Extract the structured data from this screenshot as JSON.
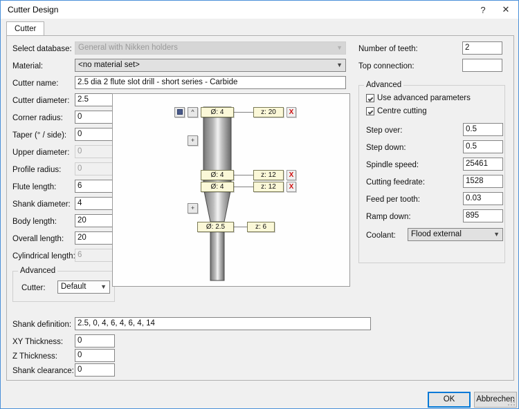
{
  "window": {
    "title": "Cutter Design",
    "help_icon": "?",
    "close_icon": "✕"
  },
  "tab": {
    "label": "Cutter"
  },
  "left": {
    "select_database": {
      "label": "Select database:",
      "value": "General with Nikken holders",
      "disabled": true
    },
    "material": {
      "label": "Material:",
      "value": "<no material set>",
      "disabled": false
    },
    "cutter_name": {
      "label": "Cutter name:",
      "value": "2.5 dia 2 flute slot drill - short series - Carbide"
    },
    "fields": [
      {
        "label": "Cutter diameter:",
        "value": "2.5",
        "disabled": false
      },
      {
        "label": "Corner radius:",
        "value": "0",
        "disabled": false
      },
      {
        "label": "Taper (° / side):",
        "value": "0",
        "disabled": false
      },
      {
        "label": "Upper diameter:",
        "value": "0",
        "disabled": true
      },
      {
        "label": "Profile radius:",
        "value": "0",
        "disabled": true
      },
      {
        "label": "Flute length:",
        "value": "6",
        "disabled": false
      },
      {
        "label": "Shank diameter:",
        "value": "4",
        "disabled": false
      },
      {
        "label": "Body length:",
        "value": "20",
        "disabled": false
      },
      {
        "label": "Overall length:",
        "value": "20",
        "disabled": false
      },
      {
        "label": "Cylindrical length:",
        "value": "6",
        "disabled": true
      }
    ],
    "advanced_group": {
      "title": "Advanced",
      "cutter_label": "Cutter:",
      "cutter_value": "Default"
    }
  },
  "right": {
    "number_of_teeth": {
      "label": "Number of teeth:",
      "value": "2"
    },
    "top_connection": {
      "label": "Top connection:",
      "value": ""
    },
    "advanced_group": {
      "title": "Advanced",
      "use_advanced_parameters": {
        "label": "Use advanced parameters",
        "checked": true
      },
      "centre_cutting": {
        "label": "Centre cutting",
        "checked": true
      },
      "fields": [
        {
          "label": "Step over:",
          "value": "0.5"
        },
        {
          "label": "Step down:",
          "value": "0.5"
        },
        {
          "label": "Spindle speed:",
          "value": "25461"
        },
        {
          "label": "Cutting feedrate:",
          "value": "1528"
        },
        {
          "label": "Feed per tooth:",
          "value": "0.03"
        },
        {
          "label": "Ramp down:",
          "value": "895"
        }
      ],
      "coolant": {
        "label": "Coolant:",
        "value": "Flood external"
      }
    }
  },
  "bottom": {
    "shank_definition": {
      "label": "Shank definition:",
      "value": "2.5, 0, 4, 6, 4, 6, 4, 14"
    },
    "xy_thickness": {
      "label": "XY Thickness:",
      "value": "0"
    },
    "z_thickness": {
      "label": "Z Thickness:",
      "value": "0"
    },
    "shank_clearance": {
      "label": "Shank clearance:",
      "value": "0"
    }
  },
  "footer": {
    "ok": "OK",
    "cancel": "Abbrechen"
  },
  "preview": {
    "buttons": {
      "view_icon": "",
      "collapse_icon": "^",
      "expand_icon_1": "+",
      "expand_icon_2": "+"
    },
    "annotations": [
      {
        "dia": "Ø: 4",
        "z": "z: 20",
        "remove": "X"
      },
      {
        "dia": "Ø: 4",
        "z": "z: 12",
        "remove": "X"
      },
      {
        "dia": "Ø: 4",
        "z": "z: 12",
        "remove": "X"
      },
      {
        "dia": "Ø: 2.5",
        "z": "z: 6",
        "remove": ""
      }
    ]
  }
}
